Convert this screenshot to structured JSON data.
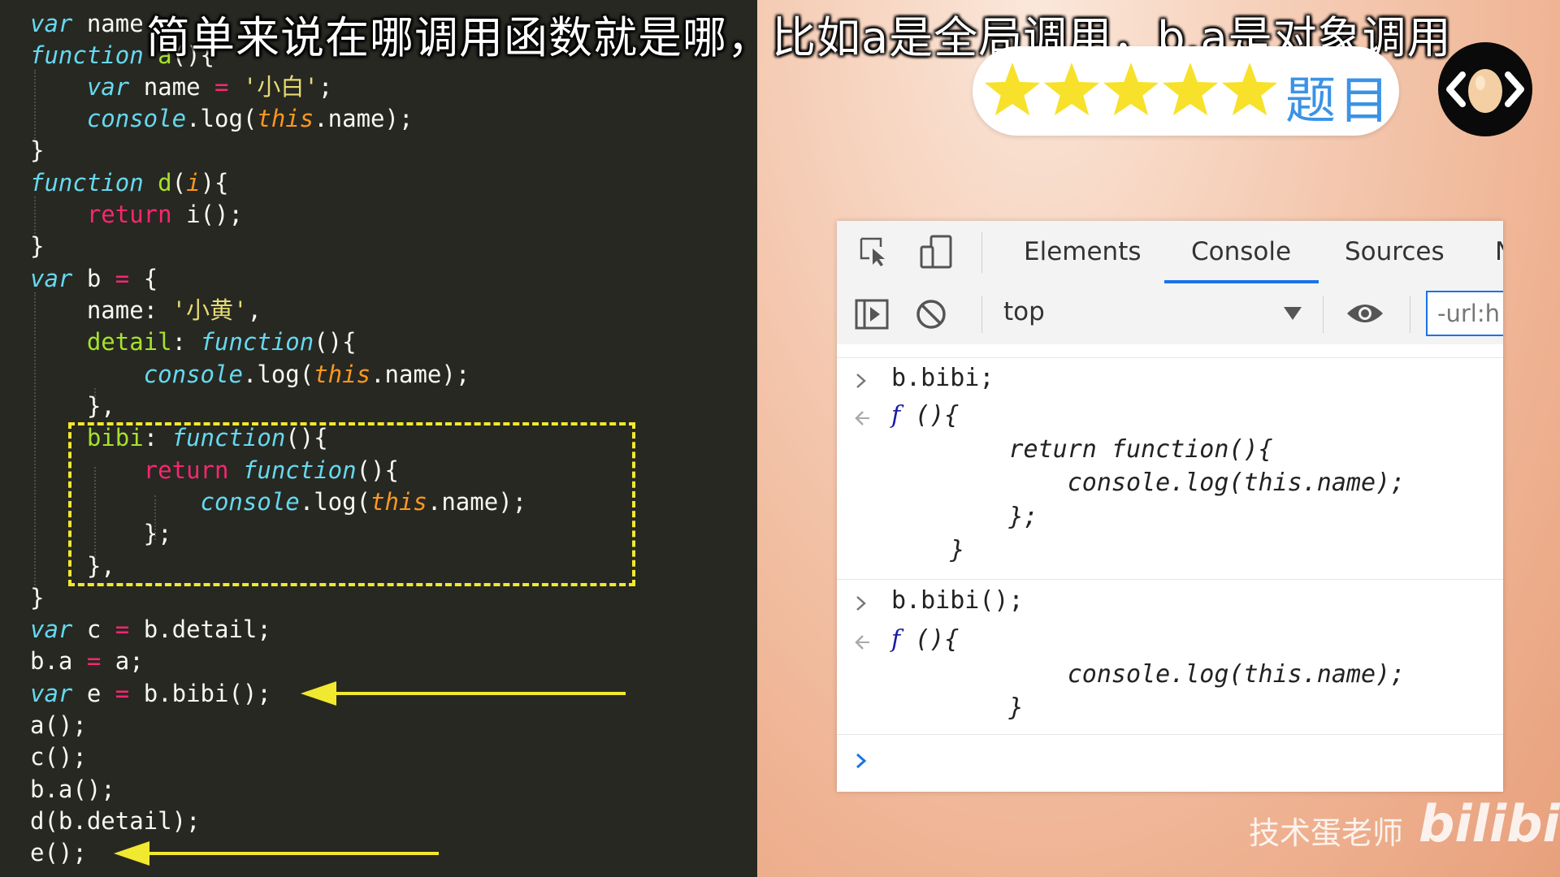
{
  "subtitle": "简单来说在哪调用函数就是哪，比如a是全局调用，b.a是对象调用",
  "badge": {
    "label": "题目",
    "stars": 5,
    "star_color": "#f7e12a",
    "label_color": "#3a93e6"
  },
  "logo": {
    "icon": "egg-code-logo"
  },
  "editor": {
    "code_lines": [
      "var name = '小白';",
      "function a(){",
      "    var name = '小白';",
      "    console.log(this.name);",
      "}",
      "function d(i){",
      "    return i();",
      "}",
      "var b = {",
      "    name: '小黄',",
      "    detail: function(){",
      "        console.log(this.name);",
      "    },",
      "    bibi: function(){",
      "        return function(){",
      "            console.log(this.name);",
      "        };",
      "    },",
      "}",
      "var c = b.detail;",
      "b.a = a;",
      "var e = b.bibi();",
      "a();",
      "c();",
      "b.a();",
      "d(b.detail);",
      "e();"
    ],
    "highlight_color": "#f1e830"
  },
  "devtools": {
    "tabs": [
      "Elements",
      "Console",
      "Sources",
      "N"
    ],
    "active_tab": "Console",
    "context": "top",
    "filter_value": "-url:h",
    "console": {
      "entries": [
        {
          "input": "b.bibi;",
          "output": [
            "f (){",
            "        return function(){",
            "            console.log(this.name);",
            "        };",
            "    }"
          ]
        },
        {
          "input": "b.bibi();",
          "output": [
            "f (){",
            "            console.log(this.name);",
            "        }"
          ]
        }
      ],
      "prompt": ">"
    }
  },
  "watermark": {
    "author": "技术蛋老师",
    "site": "bilibili"
  }
}
